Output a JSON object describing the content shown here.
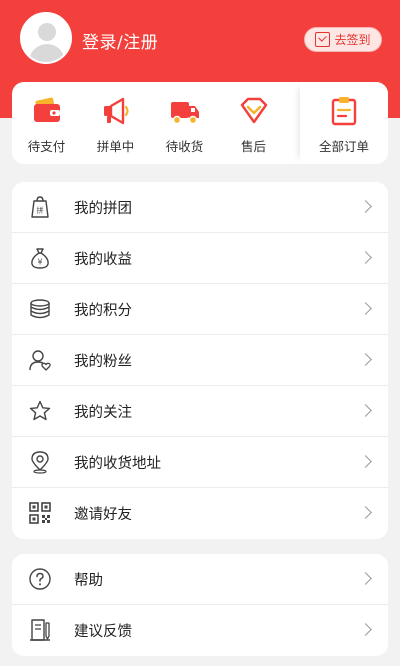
{
  "header": {
    "login_label": "登录/注册",
    "signin_label": "去签到"
  },
  "orders": [
    {
      "label": "待支付",
      "icon": "wallet-icon"
    },
    {
      "label": "拼单中",
      "icon": "megaphone-icon"
    },
    {
      "label": "待收货",
      "icon": "truck-icon"
    },
    {
      "label": "售后",
      "icon": "diamond-icon"
    }
  ],
  "orders_all": {
    "label": "全部订单",
    "icon": "clipboard-icon"
  },
  "menu1": [
    {
      "label": "我的拼团",
      "icon": "group-bag-icon"
    },
    {
      "label": "我的收益",
      "icon": "money-bag-icon"
    },
    {
      "label": "我的积分",
      "icon": "coins-icon"
    },
    {
      "label": "我的粉丝",
      "icon": "fans-icon"
    },
    {
      "label": "我的关注",
      "icon": "star-icon"
    },
    {
      "label": "我的收货地址",
      "icon": "location-icon"
    },
    {
      "label": "邀请好友",
      "icon": "qrcode-icon"
    }
  ],
  "menu2": [
    {
      "label": "帮助",
      "icon": "help-icon"
    },
    {
      "label": "建议反馈",
      "icon": "feedback-icon"
    }
  ],
  "colors": {
    "brand": "#f3403c",
    "background": "#f2f2f2"
  }
}
